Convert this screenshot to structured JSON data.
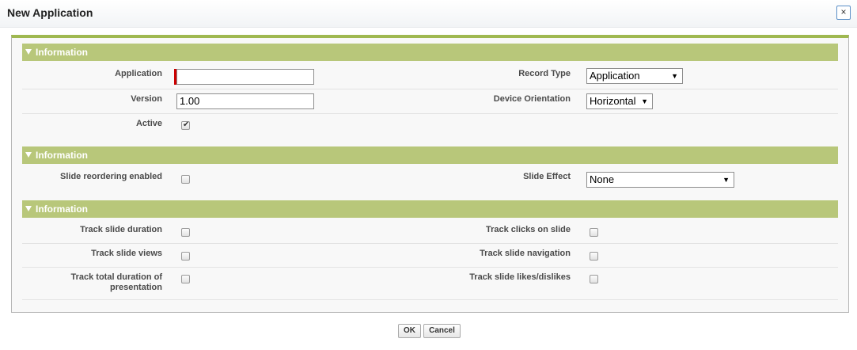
{
  "dialog": {
    "title": "New Application",
    "close_icon": "×"
  },
  "sections": [
    {
      "title": "Information"
    },
    {
      "title": "Information"
    },
    {
      "title": "Information"
    }
  ],
  "fields": {
    "application": {
      "label": "Application",
      "value": ""
    },
    "record_type": {
      "label": "Record Type",
      "value": "Application"
    },
    "version": {
      "label": "Version",
      "value": "1.00"
    },
    "device_orientation": {
      "label": "Device Orientation",
      "value": "Horizontal"
    },
    "active": {
      "label": "Active",
      "checked": true
    },
    "slide_reordering": {
      "label": "Slide reordering enabled",
      "checked": false
    },
    "slide_effect": {
      "label": "Slide Effect",
      "value": "None"
    },
    "track_slide_duration": {
      "label": "Track slide duration",
      "checked": false
    },
    "track_clicks": {
      "label": "Track clicks on slide",
      "checked": false
    },
    "track_slide_views": {
      "label": "Track slide views",
      "checked": false
    },
    "track_slide_navigation": {
      "label": "Track slide navigation",
      "checked": false
    },
    "track_total_duration": {
      "label_line1": "Track total duration of",
      "label_line2": "presentation",
      "checked": false
    },
    "track_likes": {
      "label": "Track slide likes/dislikes",
      "checked": false
    }
  },
  "buttons": {
    "ok": "OK",
    "cancel": "Cancel"
  },
  "colors": {
    "section_header": "#b8c77a",
    "accent_border": "#9fb850",
    "required_marker": "#cc0000"
  },
  "icons": {
    "section_toggle": "triangle-down-icon",
    "select_arrow": "▼",
    "check": "✔"
  }
}
